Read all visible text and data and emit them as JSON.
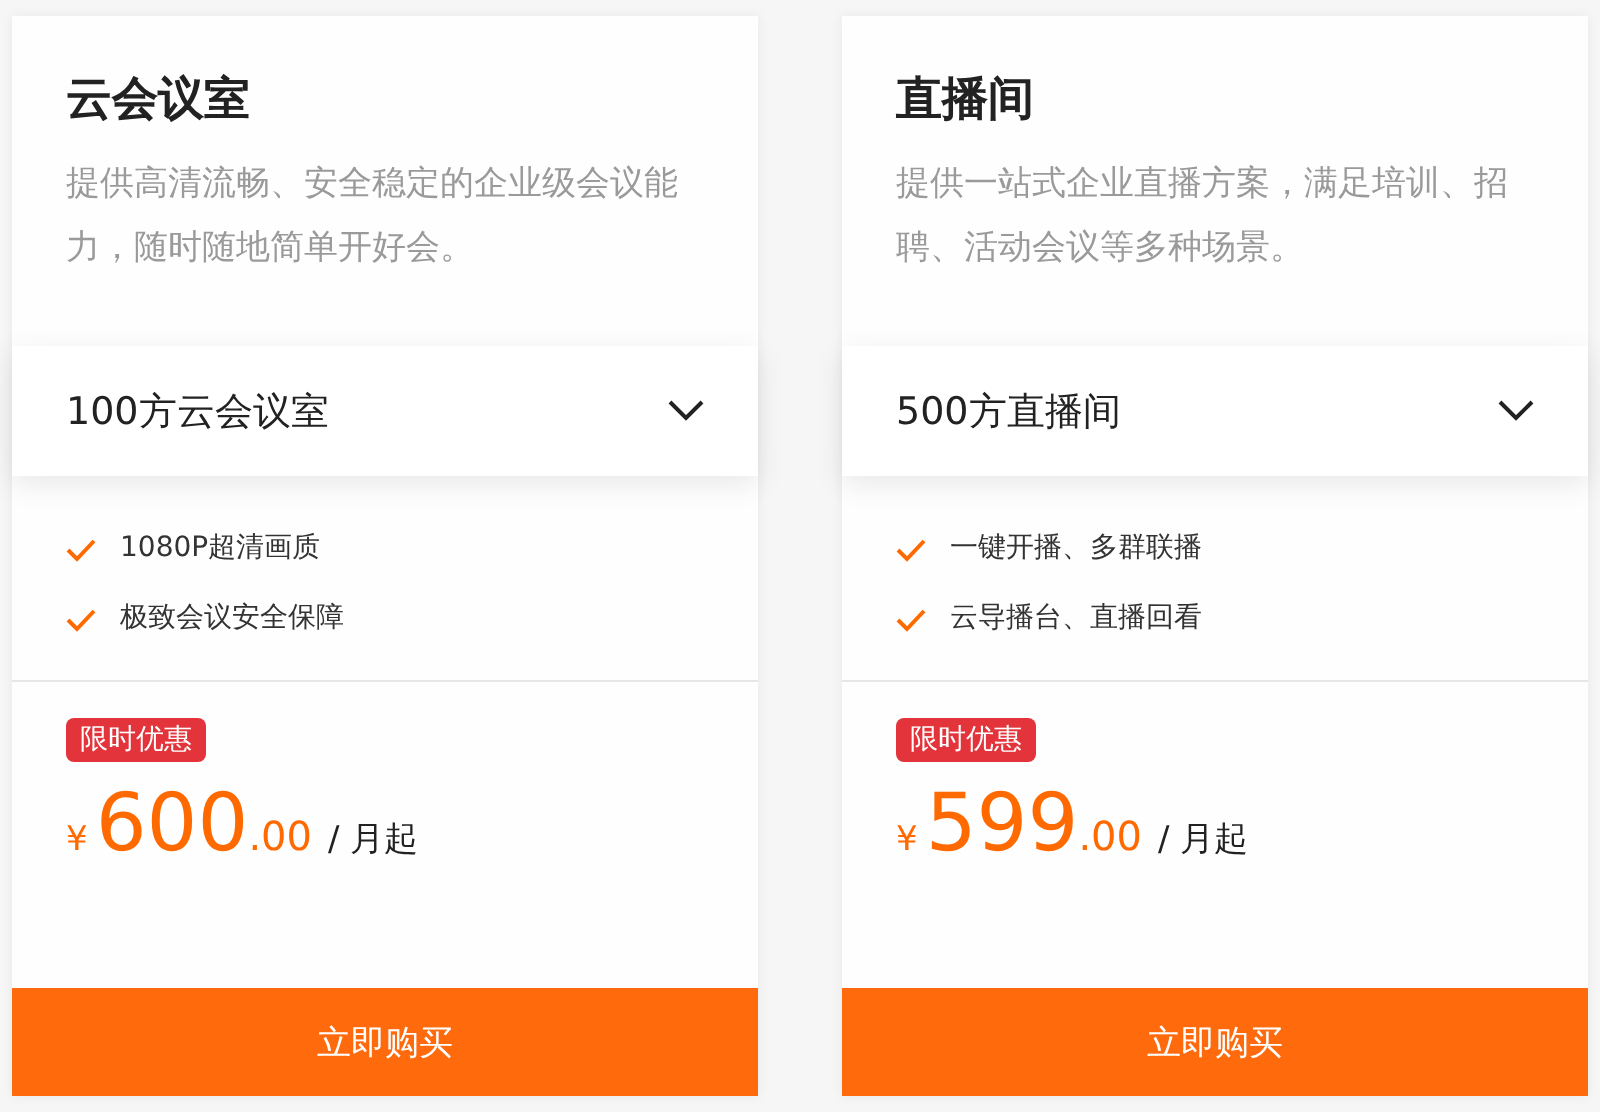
{
  "cards": [
    {
      "title": "云会议室",
      "description": "提供高清流畅、安全稳定的企业级会议能力，随时随地简单开好会。",
      "select": {
        "value": "100方云会议室"
      },
      "features": [
        "1080P超清画质",
        "极致会议安全保障"
      ],
      "badge": "限时优惠",
      "price": {
        "currency": "¥",
        "integer": "600",
        "decimal": ".00",
        "unit": "/ 月起"
      },
      "button": "立即购买"
    },
    {
      "title": "直播间",
      "description": "提供一站式企业直播方案，满足培训、招聘、活动会议等多种场景。",
      "select": {
        "value": "500方直播间"
      },
      "features": [
        "一键开播、多群联播",
        "云导播台、直播回看"
      ],
      "badge": "限时优惠",
      "price": {
        "currency": "¥",
        "integer": "599",
        "decimal": ".00",
        "unit": "/ 月起"
      },
      "button": "立即购买"
    }
  ]
}
